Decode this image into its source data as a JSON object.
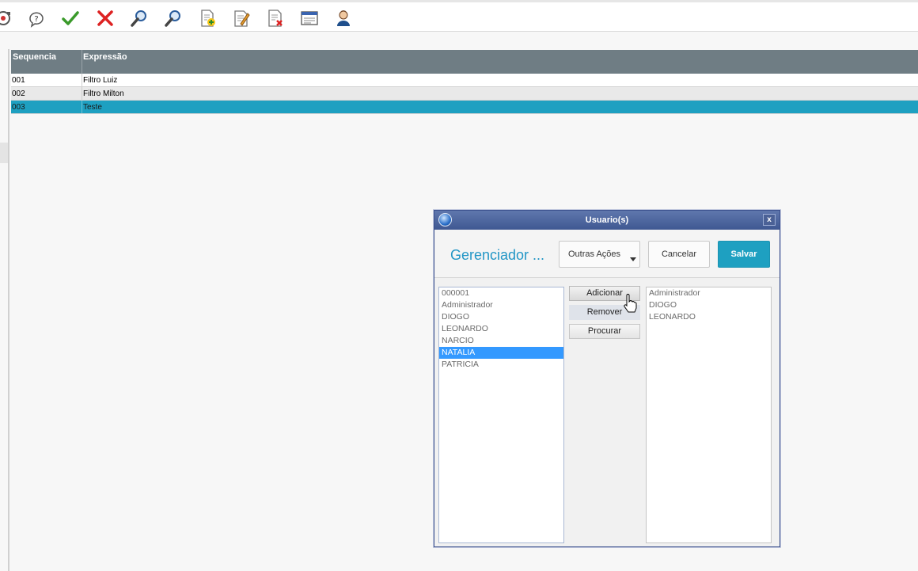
{
  "toolbar": {
    "buttons": [
      {
        "name": "refresh-icon"
      },
      {
        "name": "help-icon"
      },
      {
        "name": "confirm-check-icon"
      },
      {
        "name": "cancel-x-icon"
      },
      {
        "name": "search-icon"
      },
      {
        "name": "search-advanced-icon"
      },
      {
        "name": "add-document-icon"
      },
      {
        "name": "edit-document-icon"
      },
      {
        "name": "delete-document-icon"
      },
      {
        "name": "window-form-icon"
      },
      {
        "name": "user-icon"
      }
    ]
  },
  "grid": {
    "columns": [
      "Sequencia",
      "Expressão"
    ],
    "rows": [
      {
        "seq": "001",
        "expr": "Filtro Luiz"
      },
      {
        "seq": "002",
        "expr": "Filtro Milton"
      },
      {
        "seq": "003",
        "expr": "Teste"
      }
    ],
    "selected_row": "003"
  },
  "dialog": {
    "title": "Usuario(s)",
    "close_label": "x",
    "heading": "Gerenciador ...",
    "buttons": {
      "outras_acoes": "Outras Ações",
      "cancelar": "Cancelar",
      "salvar": "Salvar"
    },
    "available_list": [
      "000001",
      "Administrador",
      "DIOGO",
      "LEONARDO",
      "NARCIO",
      "NATALIA",
      "PATRICIA"
    ],
    "available_selected": "NATALIA",
    "move_buttons": {
      "adicionar": "Adicionar",
      "remover": "Remover",
      "procurar": "Procurar"
    },
    "selected_list": [
      "Administrador",
      "DIOGO",
      "LEONARDO"
    ]
  },
  "colors": {
    "accent": "#1ea0c1",
    "grid_header": "#6f7d84",
    "dialog_title": "#3f5892",
    "list_selection": "#3399ff"
  }
}
